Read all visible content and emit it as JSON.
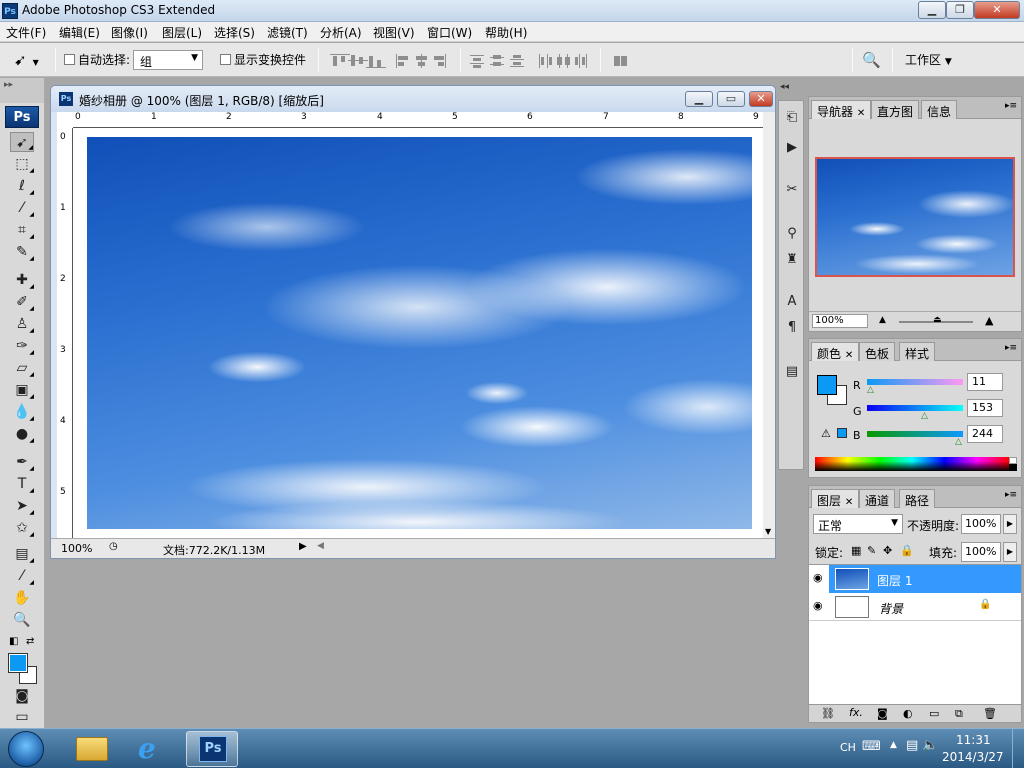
{
  "window": {
    "title": "Adobe Photoshop CS3 Extended",
    "app_icon_text": "Ps"
  },
  "menu": [
    "文件(F)",
    "编辑(E)",
    "图像(I)",
    "图层(L)",
    "选择(S)",
    "滤镜(T)",
    "分析(A)",
    "视图(V)",
    "窗口(W)",
    "帮助(H)"
  ],
  "options": {
    "auto_select_label": "自动选择:",
    "auto_select_value": "组",
    "show_transform_label": "显示变换控件",
    "workspace_label": "工作区"
  },
  "toolbar": {
    "logo": "Ps",
    "fg_color": "#0b99f4",
    "bg_color": "#ffffff"
  },
  "document": {
    "title": "婚纱相册 @ 100% (图层 1, RGB/8) [缩放后]",
    "zoom": "100%",
    "doc_info": "文档:772.2K/1.13M",
    "ruler_h": [
      "0",
      "1",
      "2",
      "3",
      "4",
      "5",
      "6",
      "7",
      "8",
      "9"
    ],
    "ruler_v": [
      "0",
      "1",
      "2",
      "3",
      "4",
      "5"
    ]
  },
  "navigator": {
    "tabs": [
      "导航器",
      "直方图",
      "信息"
    ],
    "zoom": "100%"
  },
  "color_panel": {
    "tabs": [
      "颜色",
      "色板",
      "样式"
    ],
    "r_label": "R",
    "g_label": "G",
    "b_label": "B",
    "r_value": "11",
    "g_value": "153",
    "b_value": "244",
    "swatch_color": "#0b99f4"
  },
  "layers_panel": {
    "tabs": [
      "图层",
      "通道",
      "路径"
    ],
    "blend_mode": "正常",
    "opacity_label": "不透明度:",
    "opacity_value": "100%",
    "lock_label": "锁定:",
    "fill_label": "填充:",
    "fill_value": "100%",
    "layers": [
      {
        "name": "图层 1",
        "selected": true
      },
      {
        "name": "背景",
        "selected": false,
        "locked": true
      }
    ]
  },
  "taskbar": {
    "lang": "CH",
    "time": "11:31",
    "date": "2014/3/27",
    "ps_label": "Ps"
  }
}
